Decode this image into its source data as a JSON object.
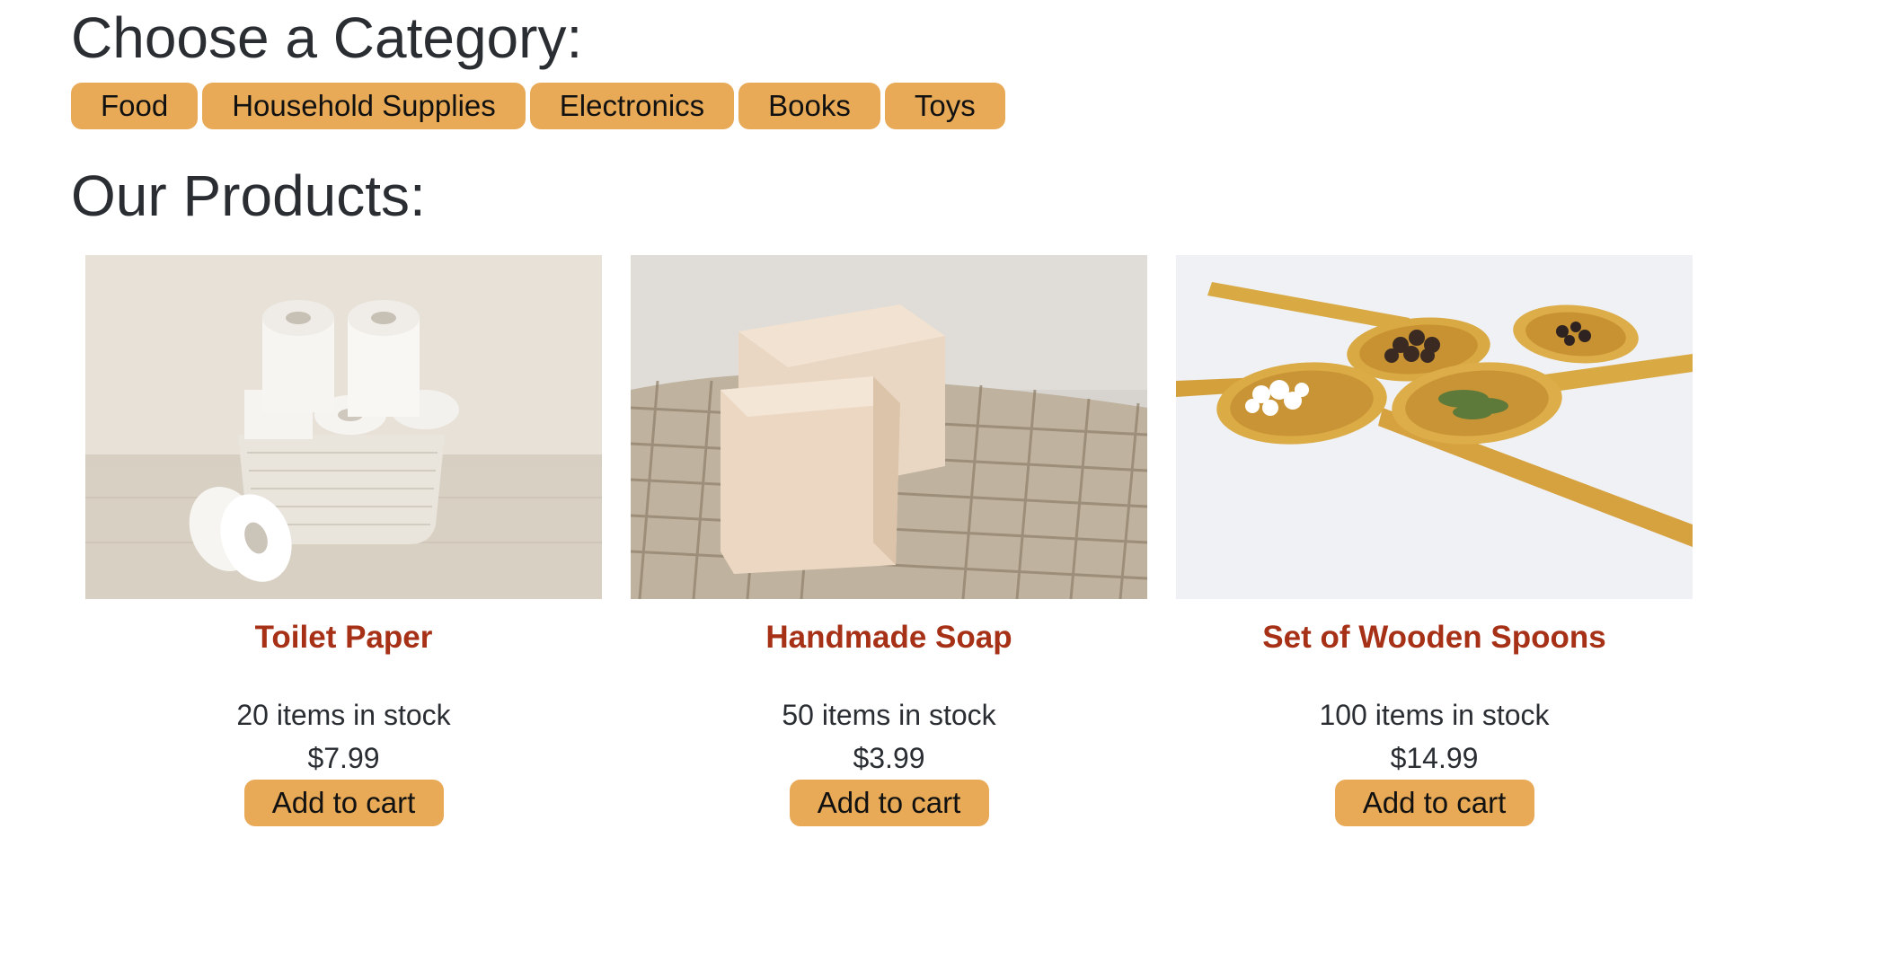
{
  "category_section": {
    "title": "Choose a Category:",
    "categories": [
      "Food",
      "Household Supplies",
      "Electronics",
      "Books",
      "Toys"
    ]
  },
  "products_section": {
    "title": "Our Products:",
    "products": [
      {
        "name": "Toilet Paper",
        "stock": "20 items in stock",
        "price": "$7.99",
        "button": "Add to cart"
      },
      {
        "name": "Handmade Soap",
        "stock": "50 items in stock",
        "price": "$3.99",
        "button": "Add to cart"
      },
      {
        "name": "Set of Wooden Spoons",
        "stock": "100 items in stock",
        "price": "$14.99",
        "button": "Add to cart"
      }
    ]
  },
  "colors": {
    "accent": "#e8aa57",
    "product_name": "#a63117",
    "text": "#2a2e33"
  }
}
